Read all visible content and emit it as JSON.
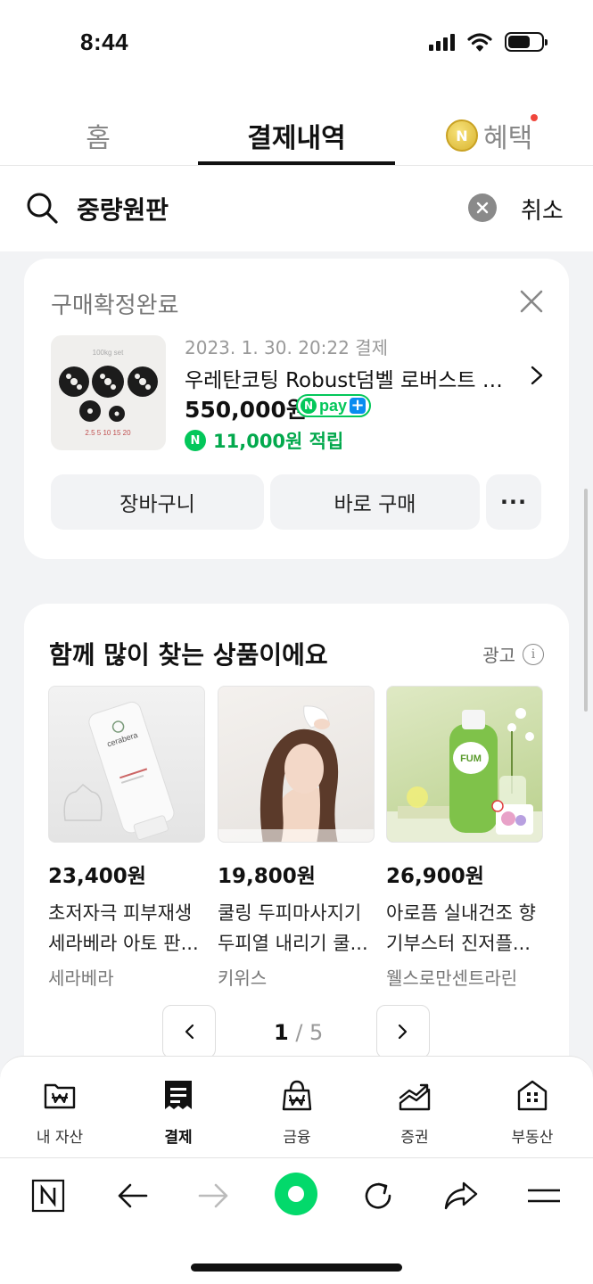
{
  "status_bar": {
    "time": "8:44"
  },
  "tabs": {
    "home": "홈",
    "payment": "결제내역",
    "benefit": "혜택",
    "coin_letter": "N"
  },
  "search": {
    "query": "중량원판",
    "cancel_label": "취소"
  },
  "order": {
    "status": "구매확정완료",
    "date": "2023. 1. 30. 20:22 결제",
    "product_name": "우레탄코팅 Robust덤벨 로버스트 원...",
    "price": "550,000원",
    "npay_text": "pay",
    "reward": "11,000원 적립",
    "cart_label": "장바구니",
    "buy_label": "바로 구매",
    "more_label": "···",
    "thumb_caption": "100kg set",
    "thumb_weights": "2.5 5 10 15 20"
  },
  "recommendations": {
    "title": "함께 많이 찾는 상품이에요",
    "ad_label": "광고",
    "items": [
      {
        "price": "23,400원",
        "name": "초저자극 피부재생 세라베라 아토 판...",
        "seller": "세라베라",
        "image_text": "cerabera"
      },
      {
        "price": "19,800원",
        "name": "쿨링 두피마사지기 두피열 내리기 쿨...",
        "seller": "키위스"
      },
      {
        "price": "26,900원",
        "name": "아로픔 실내건조 향기부스터 진저플...",
        "seller": "웰스로만센트라린",
        "image_text": "FUM"
      }
    ],
    "pager": {
      "current": "1",
      "total": "/ 5"
    }
  },
  "bottom_nav": {
    "items": [
      {
        "label": "내 자산",
        "icon": "wallet-icon"
      },
      {
        "label": "결제",
        "icon": "receipt-icon",
        "active": true
      },
      {
        "label": "금융",
        "icon": "money-bag-icon"
      },
      {
        "label": "증권",
        "icon": "stock-chart-icon"
      },
      {
        "label": "부동산",
        "icon": "building-icon"
      }
    ]
  },
  "colors": {
    "naver_green": "#03c75a",
    "npay_blue": "#0a8cf0",
    "alert_red": "#f0463c"
  }
}
